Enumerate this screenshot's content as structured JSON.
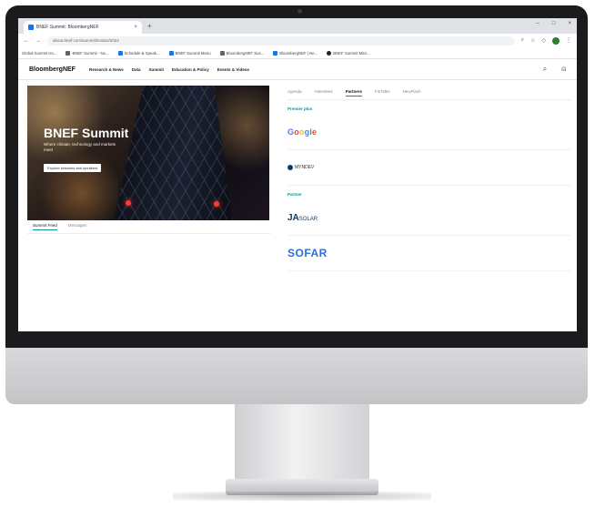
{
  "browser": {
    "tab_title": "BNEF Summit: BloombergNEF",
    "tab_close": "×",
    "new_tab": "+",
    "window_controls": [
      "–",
      "□",
      "×"
    ],
    "nav_back": "←",
    "nav_forward": "→",
    "url": "about.bnef.com/summit/london/2024",
    "bookmarks": [
      {
        "label": "Global Summit Ho..."
      },
      {
        "label": "BNEF Summit - Ne..."
      },
      {
        "label": "Schedule & Speak..."
      },
      {
        "label": "BNEF Summit Menu"
      },
      {
        "label": "BloombergNEF Sus..."
      },
      {
        "label": "BloombergNEF | Ne..."
      },
      {
        "label": "BNEF Summit Man..."
      }
    ]
  },
  "site": {
    "logo": "BloombergNEF",
    "nav": [
      "Research & News",
      "Data",
      "Summit",
      "Education & Policy",
      "Events & Videos"
    ],
    "search_icon": "⌕",
    "user_icon": "⍝"
  },
  "hero": {
    "title": "BNEF Summit",
    "subtitle": "Where climate, technology and markets meet",
    "button": "Explore sessions and speakers"
  },
  "left_tabs": {
    "active": "Summit Feed",
    "other": "Messages"
  },
  "right_tabs": {
    "items": [
      "Agenda",
      "Attendees",
      "Partners",
      "FinTalks",
      "NewFlash"
    ],
    "active_index": 2
  },
  "partners": {
    "premier_label": "Premier plus",
    "premier": [
      "Google",
      "MYNDEV"
    ],
    "partner_label": "Partner",
    "partner": [
      "JA SOLAR",
      "SOFAR"
    ],
    "ja_main": "JA",
    "ja_small": "SOLAR"
  },
  "colors": {
    "accent": "#0a9396",
    "google_blue": "#4285f4",
    "sofar_blue": "#2a6fdb"
  }
}
